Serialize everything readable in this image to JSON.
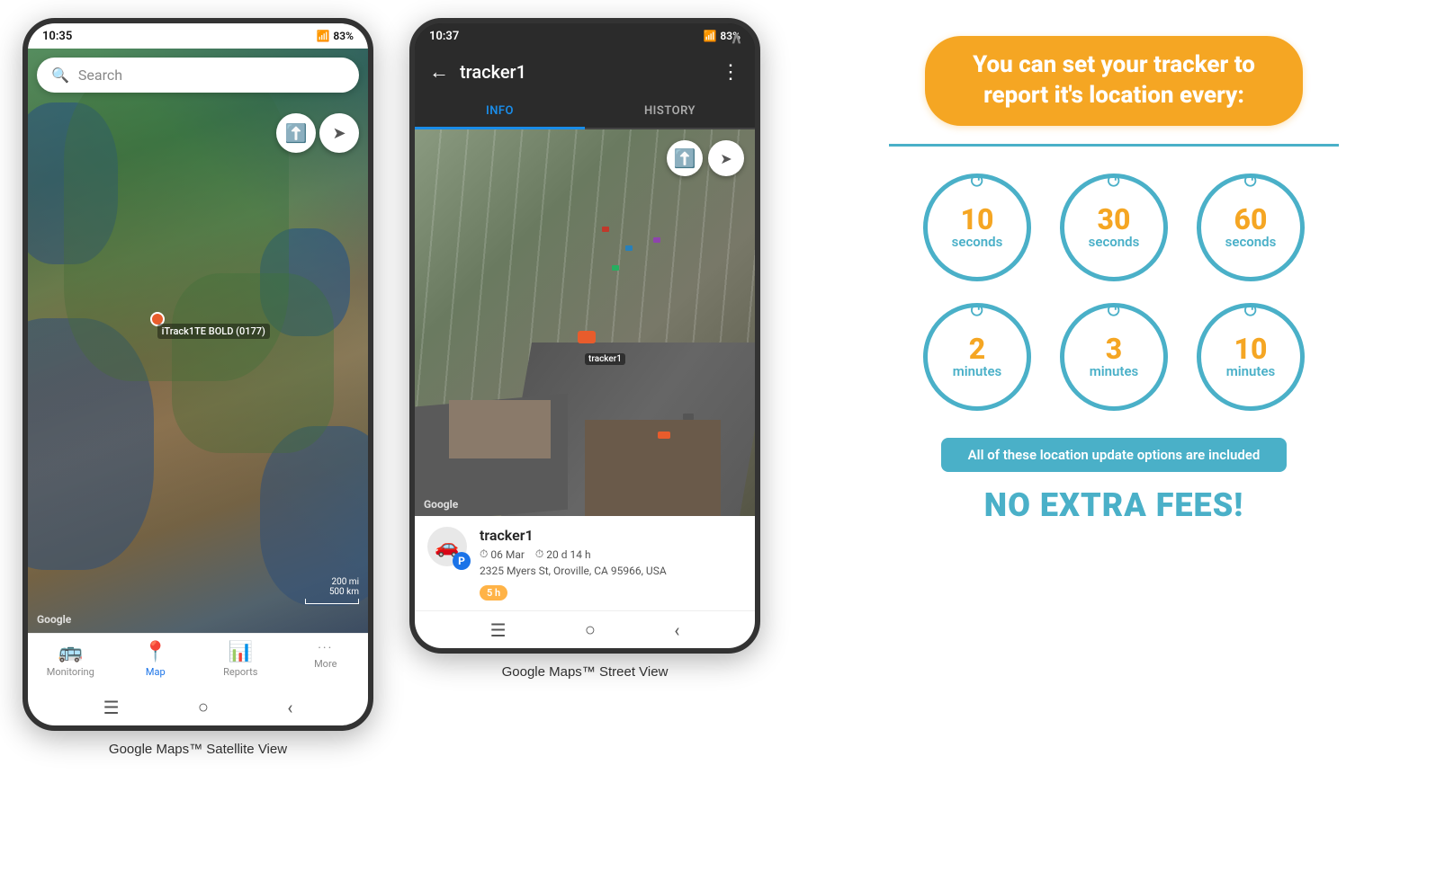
{
  "phone1": {
    "status_time": "10:35",
    "status_signal": "📶",
    "status_battery": "83%",
    "search_placeholder": "Search",
    "compass_icon": "🧭",
    "tracker_label": "iTrack1TE BOLD (0177)",
    "scale_text_top": "200 mi",
    "scale_text_bot": "500 km",
    "google_watermark": "Google",
    "nav_items": [
      {
        "label": "Monitoring",
        "icon": "🚌",
        "active": false
      },
      {
        "label": "Map",
        "icon": "📍",
        "active": true
      },
      {
        "label": "Reports",
        "icon": "📊",
        "active": false
      },
      {
        "label": "More",
        "icon": "···",
        "active": false
      }
    ],
    "caption": "Google Maps™ Satellite View"
  },
  "phone2": {
    "status_time": "10:37",
    "status_battery": "83%",
    "title": "tracker1",
    "tab_info": "INFO",
    "tab_history": "HISTORY",
    "google_watermark": "Google",
    "tracker_name": "tracker1",
    "tracker_date": "06 Mar",
    "tracker_duration": "20 d 14 h",
    "tracker_address": "2325 Myers St, Oroville, CA 95966, USA",
    "age_badge": "5 h",
    "compass_icon": "🧭",
    "caption": "Google Maps™ Street View"
  },
  "info_panel": {
    "headline": "You can set your tracker to report it's location every:",
    "circles": [
      {
        "number": "10",
        "unit": "seconds"
      },
      {
        "number": "30",
        "unit": "seconds"
      },
      {
        "number": "60",
        "unit": "seconds"
      },
      {
        "number": "2",
        "unit": "minutes"
      },
      {
        "number": "3",
        "unit": "minutes"
      },
      {
        "number": "10",
        "unit": "minutes"
      }
    ],
    "banner_text": "All of these location update options are included",
    "no_fees_text": "NO EXTRA FEES!"
  }
}
